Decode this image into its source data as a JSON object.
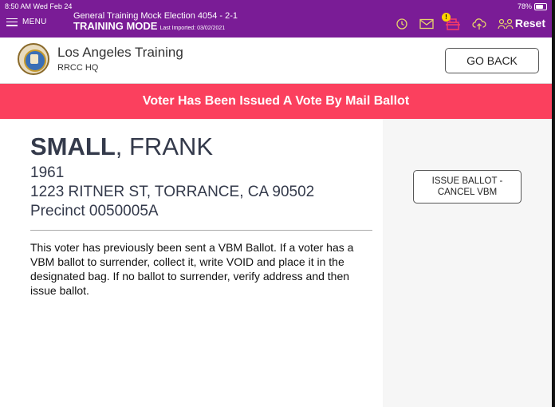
{
  "status_bar": {
    "time": "8:50 AM  Wed Feb 24",
    "battery": "78%"
  },
  "topbar": {
    "menu_label": "MENU",
    "election_title": "General Training Mock Election 4054 - 2-1",
    "mode": "TRAINING MODE",
    "last_imported": "Last Imported: 03/02/2021",
    "reset_label": "Reset",
    "notification_count": "!",
    "icons": [
      "history-icon",
      "mail-icon",
      "ballot-box-icon",
      "cloud-upload-icon",
      "users-icon"
    ],
    "icon_color": "#e6d46a"
  },
  "header": {
    "org_name": "Los Angeles Training",
    "org_sub": "RRCC HQ",
    "go_back_label": "GO BACK"
  },
  "banner": {
    "text": "Voter Has Been Issued A Vote By Mail Ballot",
    "color": "#fb405e"
  },
  "voter": {
    "last_name": "SMALL",
    "first_name": ", FRANK",
    "birth_year": "1961",
    "address": "1223 RITNER ST, TORRANCE, CA 90502",
    "precinct": "Precinct 0050005A"
  },
  "message": "This voter has previously been sent a VBM Ballot.  If a voter has a VBM ballot to surrender, collect it, write VOID and place it in the designated bag.  If no ballot to surrender, verify address and then issue ballot.",
  "actions": {
    "issue_line1": "ISSUE BALLOT -",
    "issue_line2": "CANCEL VBM"
  }
}
